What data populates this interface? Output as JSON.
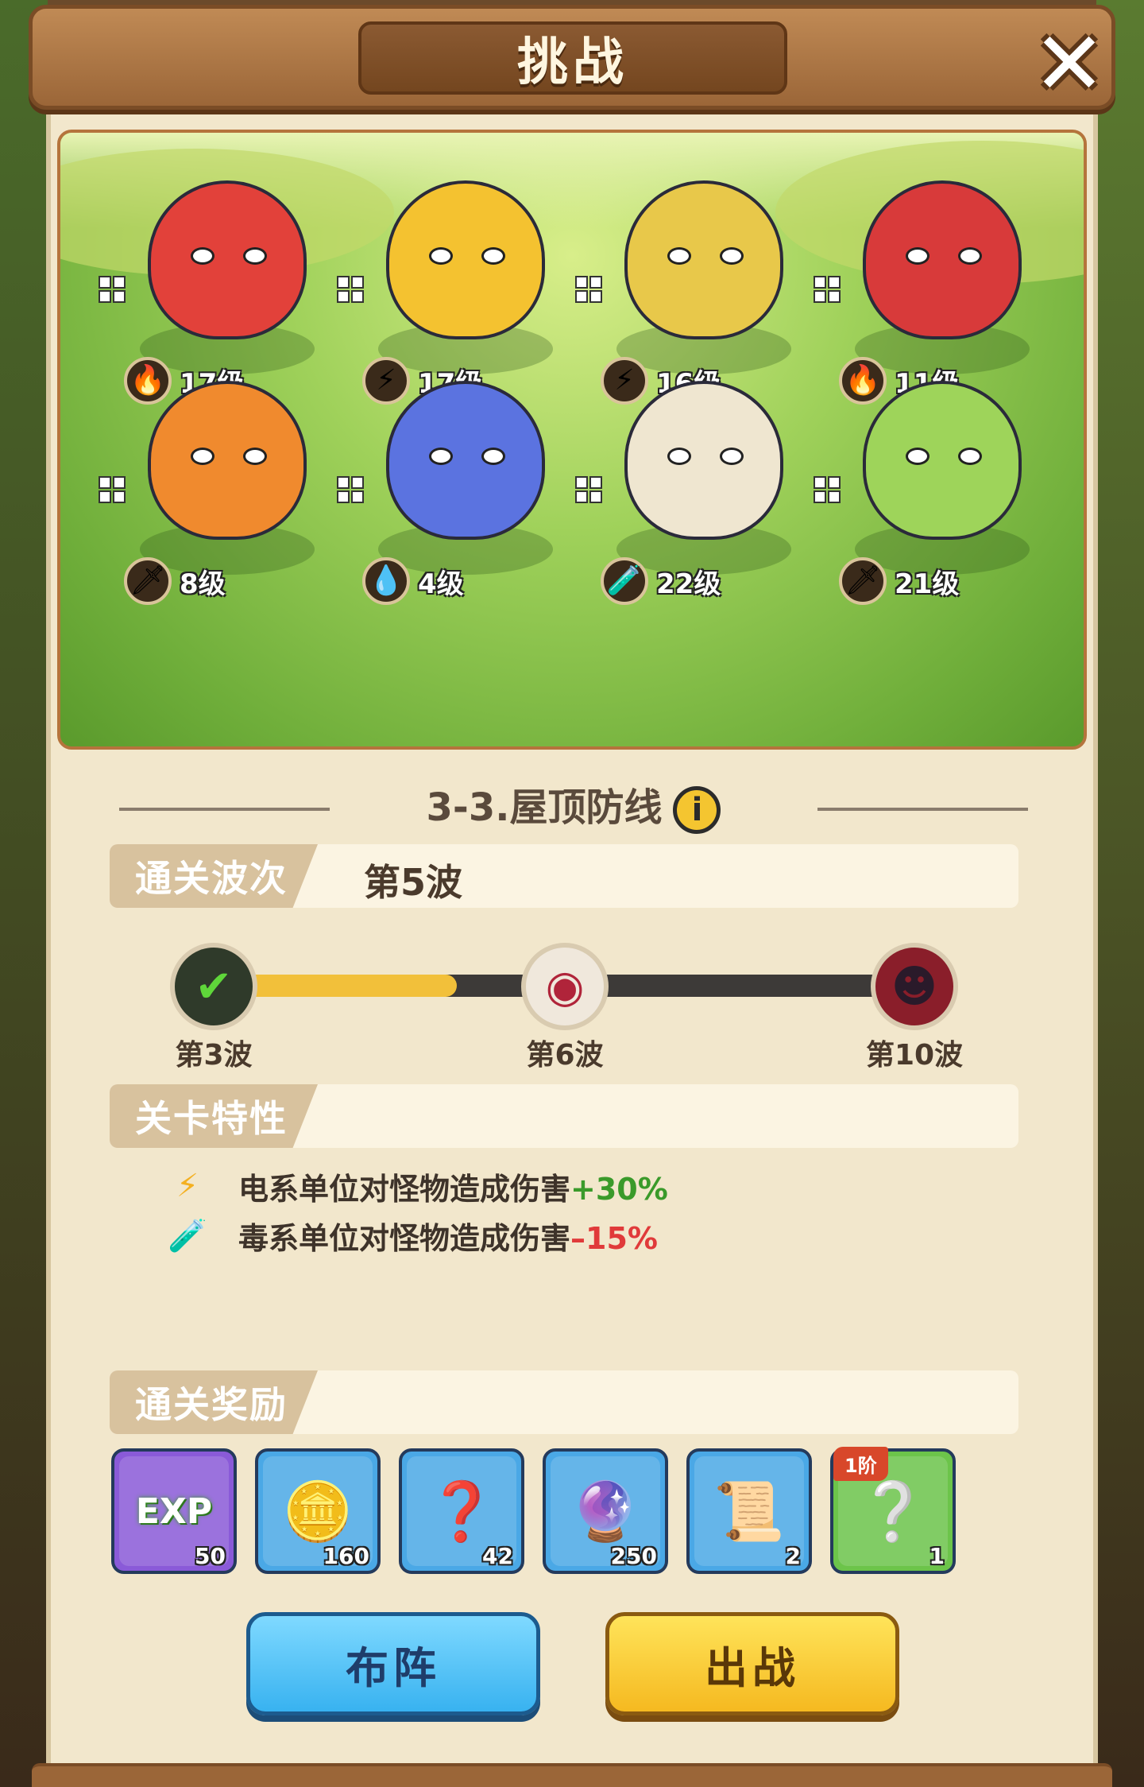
{
  "header": {
    "title": "挑战"
  },
  "enemies": [
    {
      "name": "double-tomato",
      "element": "fire",
      "element_icon": "🔥",
      "level": "17级",
      "color": "#e2413a"
    },
    {
      "name": "pineapple-king",
      "element": "electric",
      "element_icon": "⚡",
      "level": "17级",
      "color": "#f4c230"
    },
    {
      "name": "cocoon-mummy",
      "element": "electric",
      "element_icon": "⚡",
      "level": "16级",
      "color": "#e8c84a"
    },
    {
      "name": "rose-gunner",
      "element": "fire",
      "element_icon": "🔥",
      "level": "11级",
      "color": "#d83a3a"
    },
    {
      "name": "carrot-wizard",
      "element": "steel",
      "element_icon": "🗡",
      "level": "8级",
      "color": "#f08a2e"
    },
    {
      "name": "blue-mage",
      "element": "water",
      "element_icon": "💧",
      "level": "4级",
      "color": "#5b73e0"
    },
    {
      "name": "pirate-mushroom",
      "element": "poison",
      "element_icon": "🧪",
      "level": "22级",
      "color": "#efe6d0"
    },
    {
      "name": "cabbage-sailor",
      "element": "steel",
      "element_icon": "🗡",
      "level": "21级",
      "color": "#9ed45a"
    }
  ],
  "stage": {
    "title": "3-3.屋顶防线",
    "info_icon": "i"
  },
  "clear_wave": {
    "label": "通关波次",
    "value": "第5波"
  },
  "progress": {
    "fraction": 0.32,
    "nodes": [
      {
        "label": "第3波",
        "icon": "check-icon"
      },
      {
        "label": "第6波",
        "icon": "eye-monster-icon"
      },
      {
        "label": "第10波",
        "icon": "boss-monster-icon"
      }
    ]
  },
  "traits": {
    "label": "关卡特性",
    "items": [
      {
        "icon": "⚡",
        "text": "电系单位对怪物造成伤害",
        "value": "+30%"
      },
      {
        "icon": "🧪",
        "text": "毒系单位对怪物造成伤害",
        "value": "–15%"
      }
    ]
  },
  "rewards": {
    "label": "通关奖励",
    "items": [
      {
        "name": "exp",
        "glyph": "EXP",
        "count": "50",
        "bg": "#8a5ad8"
      },
      {
        "name": "coin",
        "glyph": "🪙",
        "count": "160",
        "bg": "#4aa8e6"
      },
      {
        "name": "mystery-seed",
        "glyph": "❓",
        "count": "42",
        "bg": "#4aa8e6"
      },
      {
        "name": "flame-orb",
        "glyph": "🔮",
        "count": "250",
        "bg": "#4aa8e6"
      },
      {
        "name": "mystery-scroll",
        "glyph": "📜",
        "count": "2",
        "bg": "#4aa8e6"
      },
      {
        "name": "mystery-gear",
        "glyph": "❔",
        "count": "1",
        "bg": "#6cc44a",
        "tier": "1阶"
      }
    ]
  },
  "buttons": {
    "formation": "布阵",
    "battle": "出战"
  }
}
